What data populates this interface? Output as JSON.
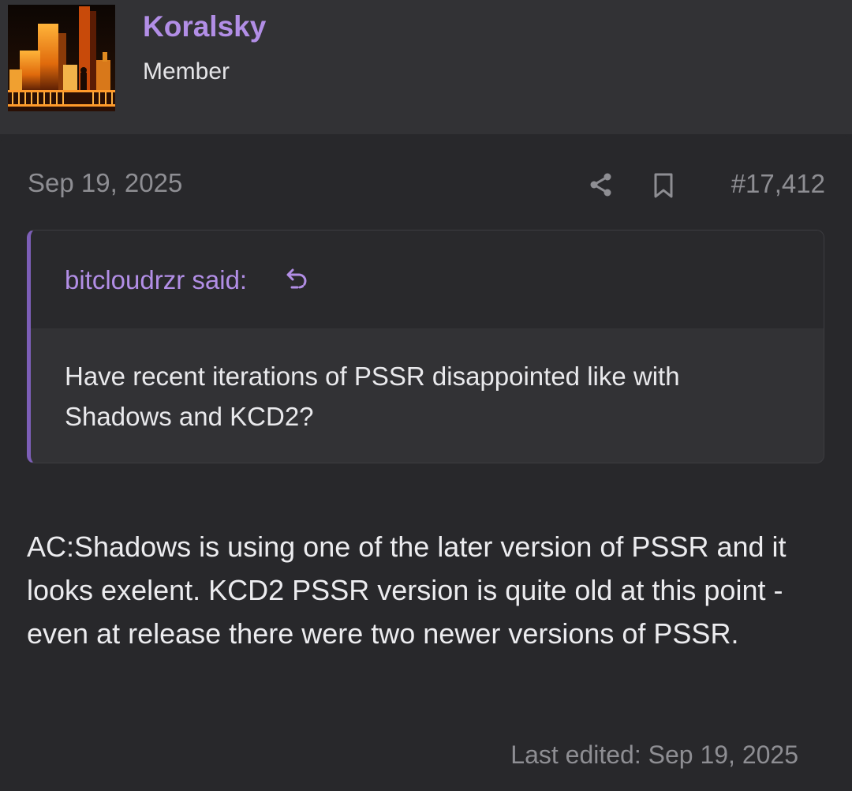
{
  "user": {
    "name": "Koralsky",
    "title": "Member"
  },
  "post": {
    "date": "Sep 19, 2025",
    "number": "#17,412",
    "quote": {
      "author_line": "bitcloudrzr said:",
      "text": "Have recent iterations of PSSR disappointed like with Shadows and KCD2?"
    },
    "body": "AC:Shadows is using one of the later version of PSSR and it looks exelent. KCD2 PSSR version is quite old at this point - even at release there were two newer versions of PSSR.",
    "last_edited": "Last edited: Sep 19, 2025"
  },
  "icons": {
    "share": "share-icon",
    "bookmark": "bookmark-icon",
    "quote_jump": "arrow-up-left-icon"
  },
  "colors": {
    "accent": "#b28ee6",
    "quote_border": "#7d5fb8",
    "background": "#28282b",
    "header_background": "#323235",
    "muted_text": "#8e8e93"
  }
}
